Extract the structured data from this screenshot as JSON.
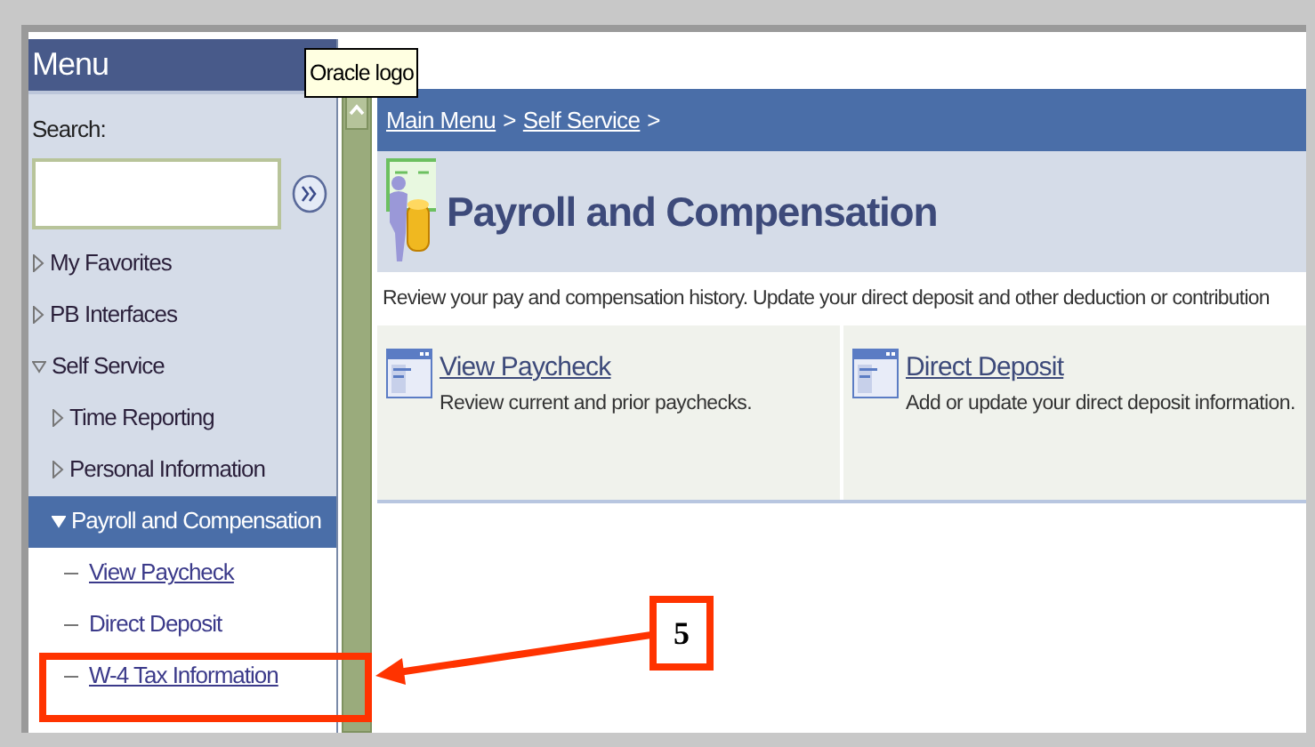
{
  "menu": {
    "title": "Menu",
    "search_label": "Search:",
    "items": [
      {
        "label": "My Favorites",
        "expanded": false,
        "selected": false
      },
      {
        "label": "PB Interfaces",
        "expanded": false,
        "selected": false
      },
      {
        "label": "Self Service",
        "expanded": true,
        "selected": false,
        "children": [
          {
            "label": "Time Reporting",
            "expanded": false,
            "selected": false
          },
          {
            "label": "Personal Information",
            "expanded": false,
            "selected": false
          },
          {
            "label": "Payroll and Compensation",
            "expanded": true,
            "selected": true,
            "children": [
              {
                "label": "View Paycheck",
                "selected": false,
                "underlined": true
              },
              {
                "label": "Direct Deposit",
                "selected": false,
                "underlined": false
              },
              {
                "label": "W-4 Tax Information",
                "selected": false,
                "underlined": true
              }
            ]
          }
        ]
      }
    ]
  },
  "tooltip": "Oracle logo",
  "breadcrumb": [
    "Main Menu",
    "Self Service"
  ],
  "breadcrumb_separator": ">",
  "page_title": "Payroll and Compensation",
  "description": "Review your pay and compensation history. Update your direct deposit and other deduction or contribution",
  "cards": [
    {
      "title": "View Paycheck",
      "text": "Review current and prior paychecks."
    },
    {
      "title": "Direct Deposit",
      "text": "Add or update your direct deposit information."
    }
  ],
  "annotation": {
    "label": "5"
  }
}
